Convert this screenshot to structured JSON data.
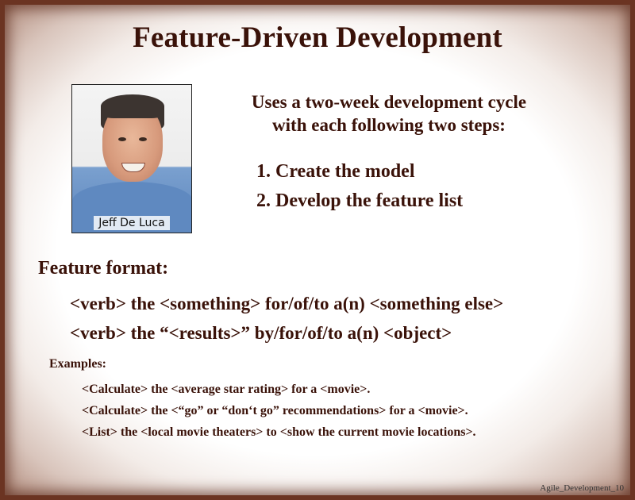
{
  "slide": {
    "title": "Feature-Driven Development",
    "photo_caption": "Jeff De Luca",
    "intro_line1": "Uses a two-week development cycle",
    "intro_line2": "with each following two steps:",
    "steps": [
      "1. Create the model",
      "2. Develop the feature list"
    ],
    "format_heading": "Feature format:",
    "formats": [
      "<verb> the <something> for/of/to a(n) <something else>",
      "<verb> the “<results>” by/for/of/to a(n) <object>"
    ],
    "examples_heading": "Examples:",
    "examples": [
      "<Calculate> the <average star rating> for a <movie>.",
      "<Calculate> the <“go” or “don‘t go” recommendations> for a <movie>.",
      "<List> the <local movie theaters> to <show the current movie locations>."
    ],
    "footer": "Agile_Development_10"
  }
}
